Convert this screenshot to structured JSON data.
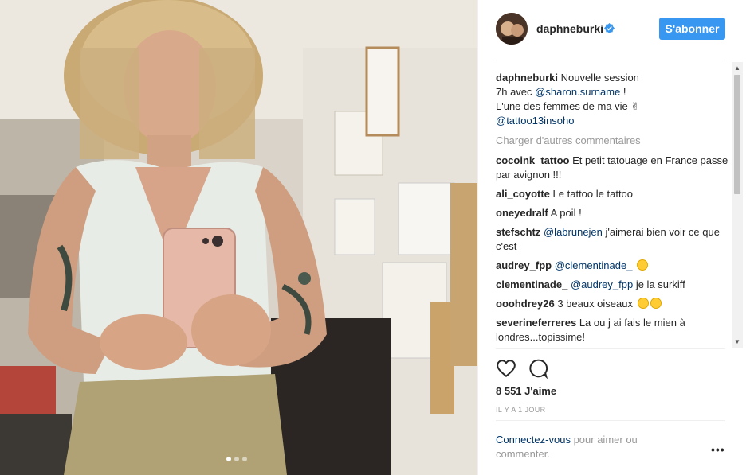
{
  "post": {
    "author": {
      "username": "daphneburki",
      "verified_icon": "verified-badge-icon"
    },
    "follow_label": "S'abonner",
    "caption": {
      "username": "daphneburki",
      "line1": "Nouvelle session",
      "line2_prefix": "7h avec ",
      "line2_mention": "@sharon.surname",
      "line2_suffix": " !",
      "line3": "L'une des femmes de ma vie",
      "line4_mention": "@tattoo13insoho"
    },
    "load_more": "Charger d'autres commentaires",
    "comments": [
      {
        "username": "cocoink_tattoo",
        "mention": "",
        "text": "Et petit tatouage en France passe par avignon !!!",
        "emoji_count": 0
      },
      {
        "username": "ali_coyotte",
        "mention": "",
        "text": "Le tattoo le tattoo",
        "emoji_count": 0
      },
      {
        "username": "oneyedralf",
        "mention": "",
        "text": "A poil !",
        "emoji_count": 0
      },
      {
        "username": "stefschtz",
        "mention": "@labrunejen",
        "text": "j'aimerai bien voir ce que c'est",
        "emoji_count": 0
      },
      {
        "username": "audrey_fpp",
        "mention": "@clementinade_",
        "text": "",
        "emoji_count": 1
      },
      {
        "username": "clementinade_",
        "mention": "@audrey_fpp",
        "text": "je la surkiff",
        "emoji_count": 0
      },
      {
        "username": "ooohdrey26",
        "mention": "",
        "text": "3 beaux oiseaux",
        "emoji_count": 2
      },
      {
        "username": "severineferreres",
        "mention": "",
        "text": "La ou j ai fais le mien à londres...topissime!",
        "emoji_count": 0
      }
    ],
    "likes": "8 551 J'aime",
    "timestamp": "IL Y A 1 JOUR",
    "login_prompt": {
      "link": "Connectez-vous",
      "rest": " pour aimer ou commenter."
    },
    "more_label": "•••",
    "icons": {
      "like": "heart-icon",
      "comment": "comment-bubble-icon",
      "more": "more-options-icon"
    },
    "carousel": {
      "total": 3,
      "active": 1
    },
    "colors": {
      "follow_button": "#3897f0",
      "mention": "#003569",
      "muted": "#999999",
      "text": "#262626"
    }
  }
}
